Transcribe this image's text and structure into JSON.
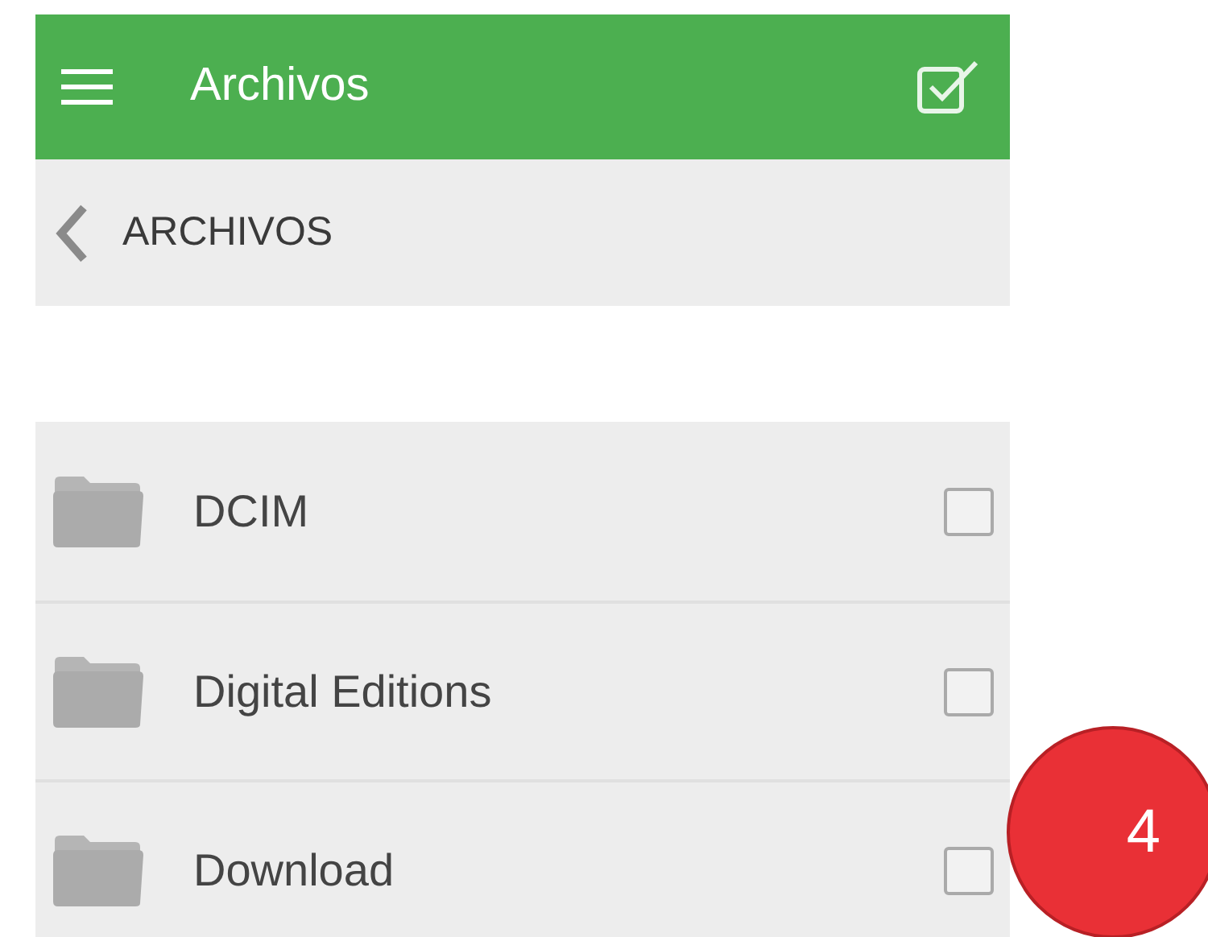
{
  "app_bar": {
    "title": "Archivos"
  },
  "breadcrumb": {
    "label": "ARCHIVOS"
  },
  "folders": [
    {
      "name": "DCIM",
      "checked": false
    },
    {
      "name": "Digital Editions",
      "checked": false
    },
    {
      "name": "Download",
      "checked": false
    }
  ],
  "callout": {
    "label": "4"
  }
}
